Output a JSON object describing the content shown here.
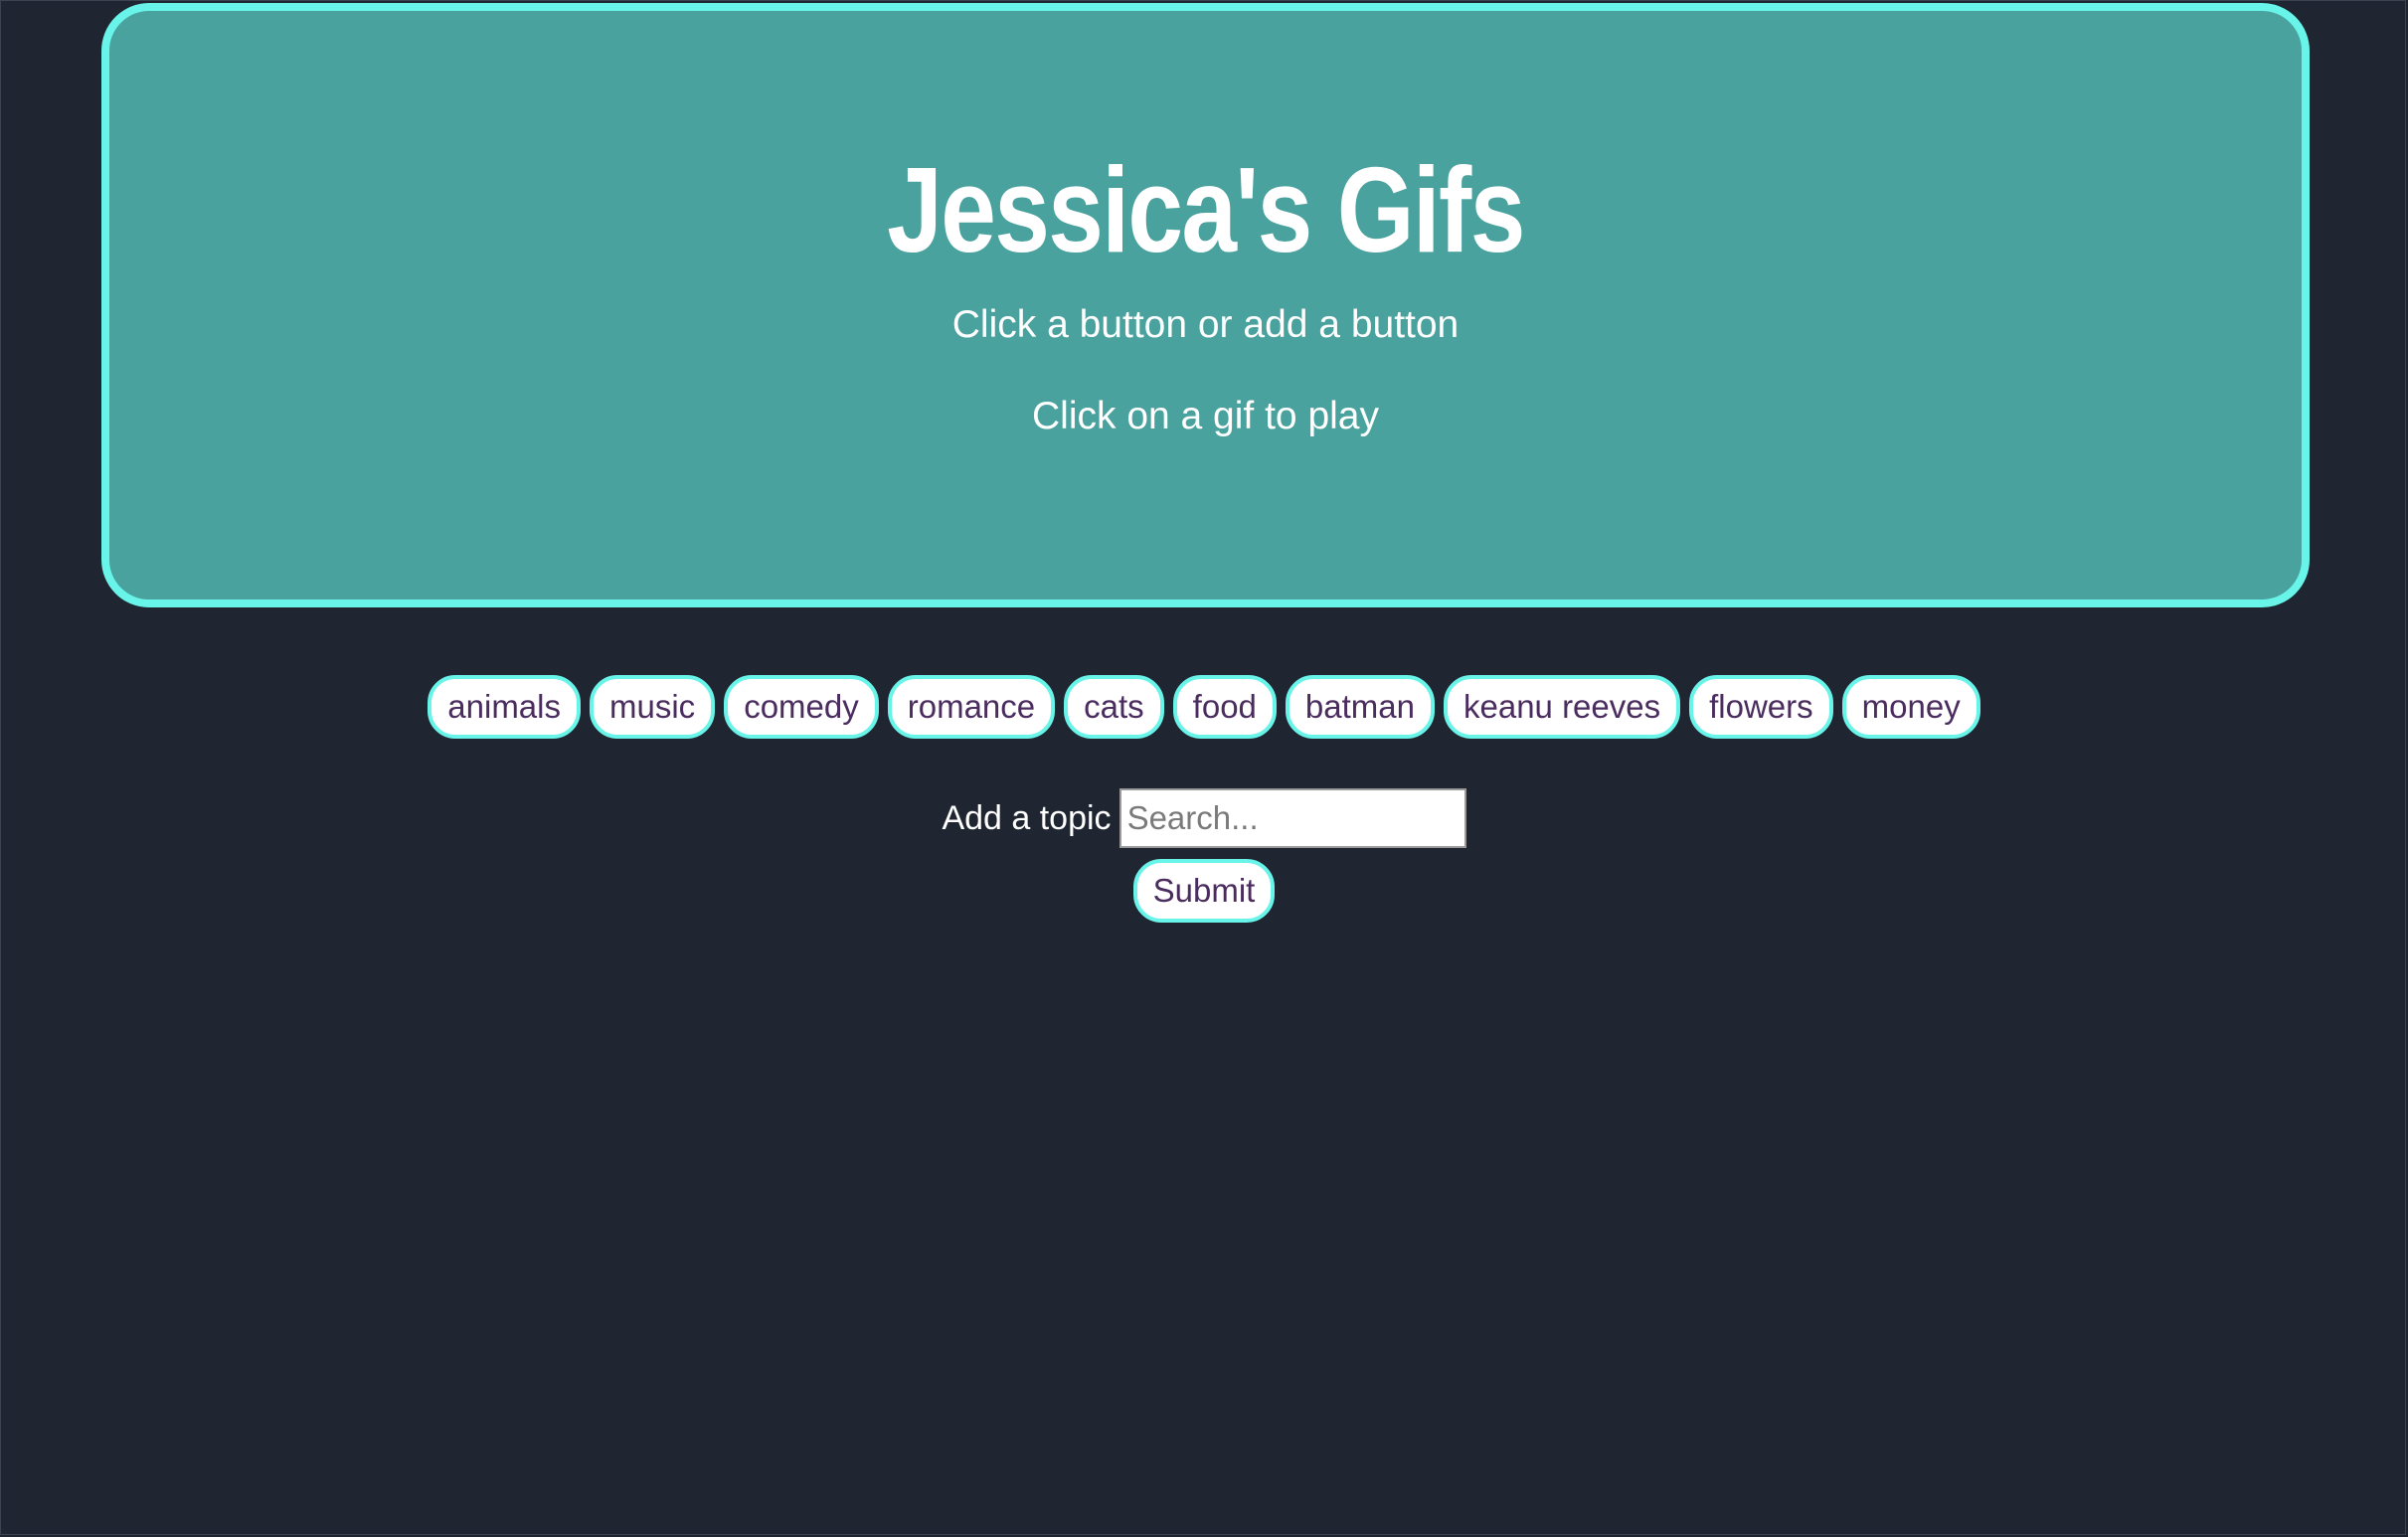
{
  "header": {
    "title": "Jessica's Gifs",
    "subtitle": "Click a button or add a button",
    "instruction": "Click on a gif to play"
  },
  "topics": [
    "animals",
    "music",
    "comedy",
    "romance",
    "cats",
    "food",
    "batman",
    "keanu reeves",
    "flowers",
    "money"
  ],
  "form": {
    "label": "Add a topic",
    "placeholder": "Search...",
    "value": "",
    "submit_label": "Submit"
  },
  "colors": {
    "page_background": "#1f2631",
    "jumbotron_background": "#4aa29f",
    "accent_border": "#68f4e8",
    "button_text": "#4a2c5e"
  }
}
